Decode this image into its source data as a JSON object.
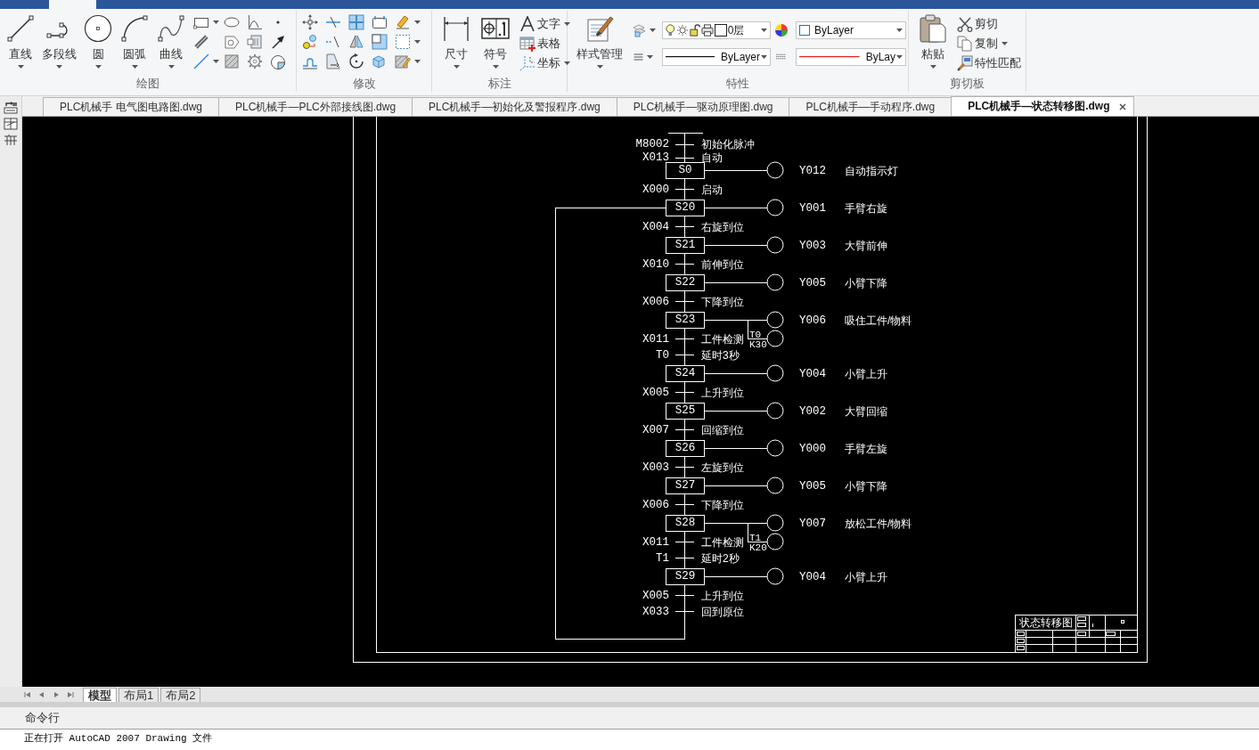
{
  "ribbon": {
    "panels": [
      {
        "title": "绘图",
        "large_tools": [
          {
            "label": "直线",
            "dropdown": true
          },
          {
            "label": "多段线",
            "dropdown": true
          },
          {
            "label": "圆",
            "dropdown": true
          },
          {
            "label": "圆弧",
            "dropdown": true
          },
          {
            "label": "曲线",
            "dropdown": true
          }
        ]
      },
      {
        "title": "修改"
      },
      {
        "title": "标注",
        "large_tools": [
          {
            "label": "尺寸",
            "dropdown": true
          },
          {
            "label": "符号",
            "dropdown": true
          }
        ],
        "small_tools": [
          {
            "label": "文字",
            "dropdown": true
          },
          {
            "label": "表格",
            "dropdown": false
          },
          {
            "label": "坐标",
            "dropdown": true
          }
        ]
      },
      {
        "title": "特性",
        "large_tools": [
          {
            "label": "样式管理",
            "dropdown": true
          }
        ],
        "layer_dropdown": {
          "value": "0层"
        },
        "color_dropdown": {
          "value": "ByLayer"
        },
        "lineweight_dropdown": {
          "value": "ByLayer"
        },
        "linetype_dropdown": {
          "value": "ByLay"
        }
      },
      {
        "title": "剪切板",
        "large_tools": [
          {
            "label": "粘贴",
            "dropdown": true
          }
        ],
        "small_tools": [
          {
            "label": "剪切",
            "dropdown": false
          },
          {
            "label": "复制",
            "dropdown": true
          },
          {
            "label": "特性匹配",
            "dropdown": false
          }
        ]
      }
    ]
  },
  "file_tabs": [
    {
      "label": "PLC机械手 电气图电路图.dwg",
      "selected": false
    },
    {
      "label": "PLC机械手—PLC外部接线图.dwg",
      "selected": false
    },
    {
      "label": "PLC机械手—初始化及警报程序.dwg",
      "selected": false
    },
    {
      "label": "PLC机械手—驱动原理图.dwg",
      "selected": false
    },
    {
      "label": "PLC机械手—手动程序.dwg",
      "selected": false
    },
    {
      "label": "PLC机械手—状态转移图.dwg",
      "selected": true
    }
  ],
  "drawing": {
    "sfc": {
      "sequence": [
        {
          "kind": "transition",
          "input": "M8002",
          "label": "初始化脉冲"
        },
        {
          "kind": "transition",
          "input": "X013",
          "label": "自动"
        },
        {
          "kind": "step",
          "name": "S0",
          "output": "Y012",
          "action": "自动指示灯",
          "loop_target": false
        },
        {
          "kind": "transition",
          "input": "X000",
          "label": "启动"
        },
        {
          "kind": "step",
          "name": "S20",
          "output": "Y001",
          "action": "手臂右旋",
          "loop_target": true
        },
        {
          "kind": "transition",
          "input": "X004",
          "label": "右旋到位"
        },
        {
          "kind": "step",
          "name": "S21",
          "output": "Y003",
          "action": "大臂前伸",
          "loop_target": false
        },
        {
          "kind": "transition",
          "input": "X010",
          "label": "前伸到位"
        },
        {
          "kind": "step",
          "name": "S22",
          "output": "Y005",
          "action": "小臂下降",
          "loop_target": false
        },
        {
          "kind": "transition",
          "input": "X006",
          "label": "下降到位"
        },
        {
          "kind": "step",
          "name": "S23",
          "output": "Y006",
          "action": "吸住工件/物料",
          "loop_target": false,
          "timer": {
            "name": "T0",
            "preset": "K30"
          }
        },
        {
          "kind": "transition",
          "input": "X011",
          "label": "工件检测"
        },
        {
          "kind": "transition",
          "input": "T0",
          "label": "延时3秒"
        },
        {
          "kind": "step",
          "name": "S24",
          "output": "Y004",
          "action": "小臂上升",
          "loop_target": false
        },
        {
          "kind": "transition",
          "input": "X005",
          "label": "上升到位"
        },
        {
          "kind": "step",
          "name": "S25",
          "output": "Y002",
          "action": "大臂回缩",
          "loop_target": false
        },
        {
          "kind": "transition",
          "input": "X007",
          "label": "回缩到位"
        },
        {
          "kind": "step",
          "name": "S26",
          "output": "Y000",
          "action": "手臂左旋",
          "loop_target": false
        },
        {
          "kind": "transition",
          "input": "X003",
          "label": "左旋到位"
        },
        {
          "kind": "step",
          "name": "S27",
          "output": "Y005",
          "action": "小臂下降",
          "loop_target": false
        },
        {
          "kind": "transition",
          "input": "X006",
          "label": "下降到位"
        },
        {
          "kind": "step",
          "name": "S28",
          "output": "Y007",
          "action": "放松工件/物料",
          "loop_target": false,
          "timer": {
            "name": "T1",
            "preset": "K20"
          }
        },
        {
          "kind": "transition",
          "input": "X011",
          "label": "工件检测"
        },
        {
          "kind": "transition",
          "input": "T1",
          "label": "延时2秒"
        },
        {
          "kind": "step",
          "name": "S29",
          "output": "Y004",
          "action": "小臂上升",
          "loop_target": false
        },
        {
          "kind": "transition",
          "input": "X005",
          "label": "上升到位"
        },
        {
          "kind": "transition",
          "input": "X033",
          "label": "回到原位"
        }
      ]
    },
    "title_block": {
      "title": "状态转移图"
    }
  },
  "layout_tabs": [
    {
      "label": "模型",
      "selected": true
    },
    {
      "label": "布局1",
      "selected": false
    },
    {
      "label": "布局2",
      "selected": false
    }
  ],
  "command_line": {
    "title": "命令行",
    "history": [
      "正在打开 AutoCAD 2007 Drawing 文件"
    ]
  }
}
